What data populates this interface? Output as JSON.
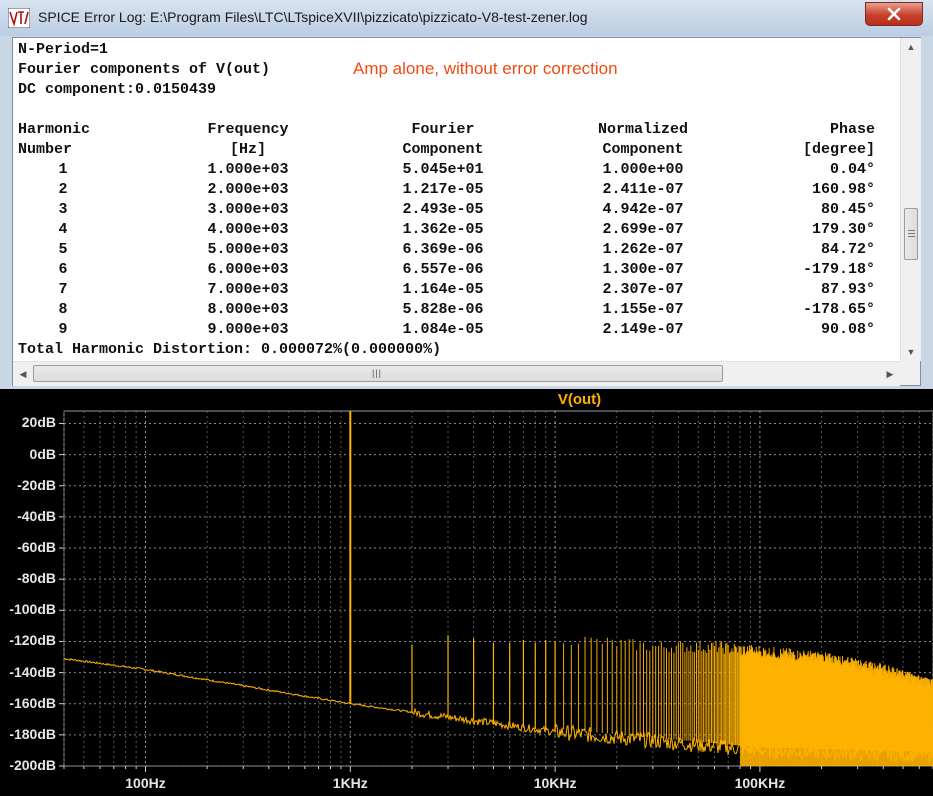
{
  "window": {
    "title": "SPICE Error Log: E:\\Program Files\\LTC\\LTspiceXVII\\pizzicato\\pizzicato-V8-test-zener.log",
    "close_icon": "close-icon",
    "app_icon": "ltspice-icon"
  },
  "log": {
    "line_nperiod": "N-Period=1",
    "line_fourier": "Fourier components of V(out)",
    "line_dc": "DC component:0.0150439",
    "annotation": "Amp alone, without error correction",
    "headers_row1": [
      "Harmonic",
      "Frequency",
      "Fourier",
      "Normalized",
      "Phase"
    ],
    "headers_row2": [
      "Number",
      "[Hz]",
      "Component",
      "Component",
      "[degree]"
    ],
    "rows": [
      [
        "1",
        "1.000e+03",
        "5.045e+01",
        "1.000e+00",
        "0.04°"
      ],
      [
        "2",
        "2.000e+03",
        "1.217e-05",
        "2.411e-07",
        "160.98°"
      ],
      [
        "3",
        "3.000e+03",
        "2.493e-05",
        "4.942e-07",
        "80.45°"
      ],
      [
        "4",
        "4.000e+03",
        "1.362e-05",
        "2.699e-07",
        "179.30°"
      ],
      [
        "5",
        "5.000e+03",
        "6.369e-06",
        "1.262e-07",
        "84.72°"
      ],
      [
        "6",
        "6.000e+03",
        "6.557e-06",
        "1.300e-07",
        "-179.18°"
      ],
      [
        "7",
        "7.000e+03",
        "1.164e-05",
        "2.307e-07",
        "87.93°"
      ],
      [
        "8",
        "8.000e+03",
        "5.828e-06",
        "1.155e-07",
        "-178.65°"
      ],
      [
        "9",
        "9.000e+03",
        "1.084e-05",
        "2.149e-07",
        "90.08°"
      ]
    ],
    "thd": "Total Harmonic Distortion: 0.000072%(0.000000%)"
  },
  "chart_data": {
    "type": "line",
    "title": "V(out)",
    "xscale": "log",
    "xlim": [
      40,
      700000
    ],
    "ylim": [
      -200,
      28
    ],
    "x_ticks": [
      100,
      1000,
      10000,
      100000
    ],
    "x_tick_labels": [
      "100Hz",
      "1KHz",
      "10KHz",
      "100KHz"
    ],
    "y_ticks": [
      20,
      0,
      -20,
      -40,
      -60,
      -80,
      -100,
      -120,
      -140,
      -160,
      -180,
      -200
    ],
    "y_tick_labels": [
      "20dB",
      "0dB",
      "-20dB",
      "-40dB",
      "-60dB",
      "-80dB",
      "-100dB",
      "-120dB",
      "-140dB",
      "-160dB",
      "-180dB",
      "-200dB"
    ],
    "grid": true,
    "series_color": "#ffb300",
    "noise_floor": [
      [
        40,
        -131
      ],
      [
        100,
        -138
      ],
      [
        1000,
        -160
      ],
      [
        10000,
        -178
      ],
      [
        100000,
        -190
      ],
      [
        700000,
        -193
      ]
    ],
    "harmonic_peaks": [
      [
        1000,
        34
      ],
      [
        2000,
        -122
      ],
      [
        3000,
        -116
      ],
      [
        4000,
        -118
      ],
      [
        5000,
        -121
      ],
      [
        6000,
        -121
      ],
      [
        7000,
        -119
      ],
      [
        8000,
        -121
      ],
      [
        9000,
        -119
      ],
      [
        10000,
        -120
      ]
    ],
    "dense_band": {
      "from_hz": 10000,
      "to_hz": 700000,
      "top_db": [
        [
          10000,
          -119
        ],
        [
          30000,
          -125
        ],
        [
          60000,
          -125
        ],
        [
          100000,
          -128
        ],
        [
          200000,
          -132
        ],
        [
          400000,
          -140
        ],
        [
          700000,
          -150
        ]
      ]
    }
  }
}
